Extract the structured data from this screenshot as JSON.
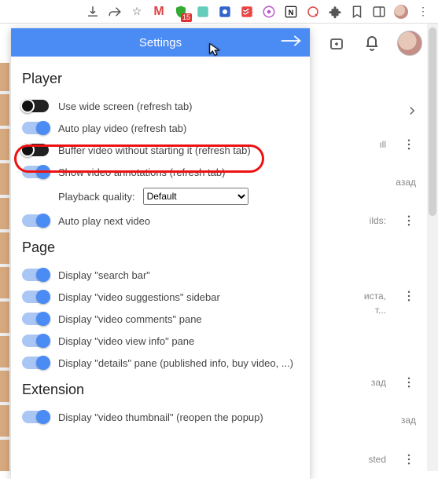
{
  "toolbar": {
    "icons": {
      "download": "download-icon",
      "share": "share-icon",
      "star": "star-icon",
      "gmail_badge": "M",
      "shield_badge_text": "15",
      "bookmark": "bookmark-icon"
    }
  },
  "panel": {
    "title": "Settings",
    "sections": {
      "player": {
        "heading": "Player",
        "items": [
          {
            "label": "Use wide screen (refresh tab)",
            "on": false
          },
          {
            "label": "Auto play video (refresh tab)",
            "on": true
          },
          {
            "label": "Buffer video without starting it (refresh tab)",
            "on": false
          },
          {
            "label": "Show video annotations (refresh tab)",
            "on": true
          }
        ],
        "quality_label": "Playback quality:",
        "quality_value": "Default",
        "autoplay_next": {
          "label": "Auto play next video",
          "on": true
        }
      },
      "page": {
        "heading": "Page",
        "items": [
          {
            "label": "Display \"search bar\"",
            "on": true
          },
          {
            "label": "Display \"video suggestions\" sidebar",
            "on": true
          },
          {
            "label": "Display \"video comments\" pane",
            "on": true
          },
          {
            "label": "Display \"video view info\" pane",
            "on": true
          },
          {
            "label": "Display \"details\" pane (published info, buy video, ...)",
            "on": true
          }
        ]
      },
      "extension": {
        "heading": "Extension",
        "items": [
          {
            "label": "Display \"video thumbnail\" (reopen the popup)",
            "on": true
          }
        ]
      }
    }
  },
  "background": {
    "item1": "ıll",
    "item2": "азад",
    "item3": "ilds:",
    "item4": "иста,",
    "item4b": "т...",
    "item5": "зад",
    "item6": "sted"
  }
}
